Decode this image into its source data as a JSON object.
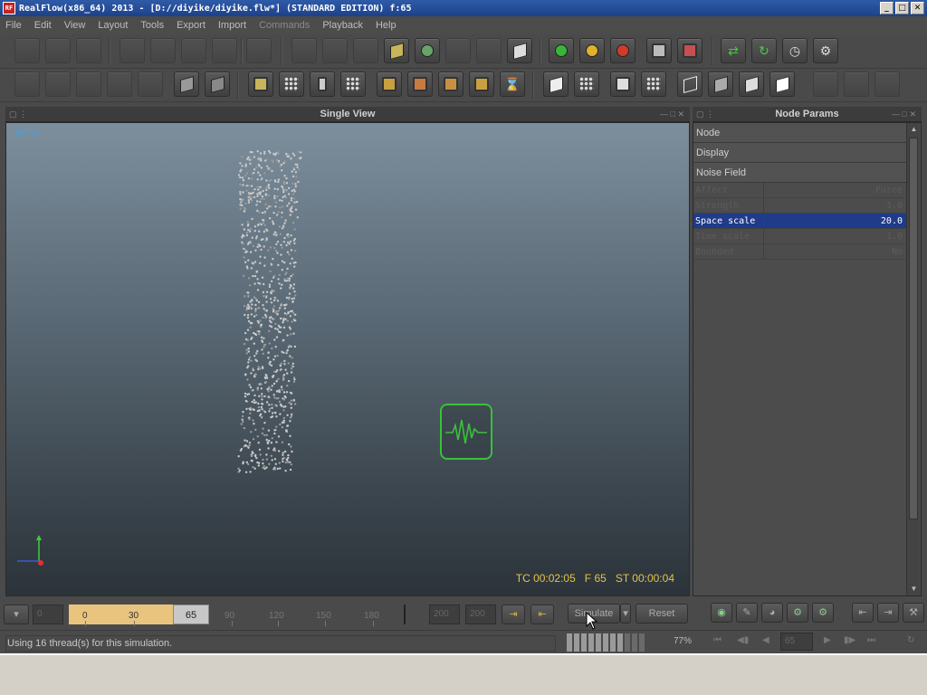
{
  "window": {
    "title": "RealFlow(x86_64) 2013 - [D://diyike/diyike.flw*] (STANDARD EDITION) f:65",
    "app_icon": "realflow-logo-icon",
    "controls": [
      "_",
      "□",
      "✕"
    ]
  },
  "menu": {
    "items": [
      "File",
      "Edit",
      "View",
      "Layout",
      "Tools",
      "Export",
      "Import",
      "Commands",
      "Playback",
      "Help"
    ],
    "disabled": [
      "Commands"
    ]
  },
  "viewport": {
    "title": "Single View",
    "camera_label": "persp",
    "hud": {
      "timecode": "TC 00:02:05",
      "frame": "F 65",
      "sim_time": "ST 00:00:04"
    },
    "colors": {
      "hud": "#e2c44a",
      "camera_label": "#4e9ed6",
      "daemon": "#38c238"
    },
    "objects": [
      "particle-column",
      "noise-field-daemon-icon",
      "axis-gizmo"
    ]
  },
  "node_params": {
    "title": "Node Params",
    "sections": [
      "Node",
      "Display",
      "Noise Field"
    ],
    "params": [
      {
        "name": "Affect",
        "value": "Force",
        "selected": false
      },
      {
        "name": "Strength",
        "value": "1.0",
        "selected": false
      },
      {
        "name": "Space scale",
        "value": "20.0",
        "selected": true
      },
      {
        "name": "Time scale",
        "value": "1.0",
        "selected": false
      },
      {
        "name": "Bounded",
        "value": "No",
        "selected": false
      }
    ],
    "selection_color": "#1f3b8a"
  },
  "timeline": {
    "start_field": "0",
    "current_frame": "65",
    "tick_labels": [
      "0",
      "30",
      "65",
      "90",
      "120",
      "150",
      "180"
    ],
    "end_fields": [
      "200",
      "200"
    ],
    "played_color": "#e9c47f"
  },
  "simulation": {
    "simulate_label": "Simulate",
    "reset_label": "Reset",
    "frame_field": "65"
  },
  "status": {
    "message": "Using 16 thread(s) for this simulation.",
    "progress_percent": "77%",
    "progress": 0.77
  }
}
